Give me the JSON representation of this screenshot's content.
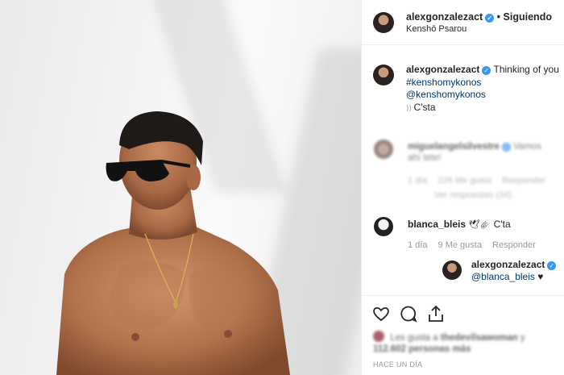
{
  "header": {
    "username": "alexgonzalezact",
    "separator": "•",
    "follow_label": "Siguiendo",
    "location": "Kenshō Psarou"
  },
  "caption": {
    "username": "alexgonzalezact",
    "text": "Thinking of you",
    "hashtag": "#kenshomykonos",
    "mention": "@kenshomykonos",
    "extra": "C'sta"
  },
  "comments": [
    {
      "username": "miguelangelsilvestre",
      "text": "Vamos ahí tete!",
      "age": "1 día",
      "likes": "226 Me gusta",
      "reply_label": "Responder",
      "view_replies": "Ver respuestas (34)"
    },
    {
      "username": "blanca_bleis",
      "text": "C'ta",
      "age": "1 día",
      "likes": "9 Me gusta",
      "reply_label": "Responder"
    }
  ],
  "reply": {
    "username": "alexgonzalezact",
    "mention": "@blanca_bleis",
    "emoji": "♥"
  },
  "likes_line": {
    "prefix": "Les gusta a",
    "user": "thedevilsawoman",
    "suffix": "y",
    "count": "112.602 personas más"
  },
  "timestamp": "HACE UN DÍA",
  "icons": {
    "like": "heart-icon",
    "comment": "comment-icon",
    "share": "share-icon",
    "verified": "verified-badge-icon"
  },
  "colors": {
    "link": "#003569",
    "verified": "#3897f0",
    "muted": "#999999"
  }
}
